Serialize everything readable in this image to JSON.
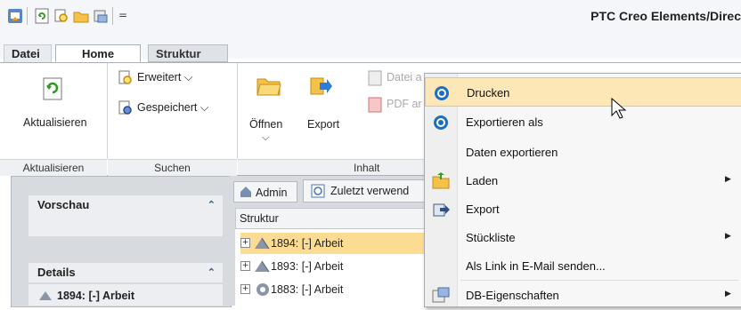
{
  "window": {
    "title": "PTC Creo Elements/Direc"
  },
  "quick_access": {
    "dropdown_glyph": "="
  },
  "tabs": [
    {
      "label": "Datei"
    },
    {
      "label": "Home"
    },
    {
      "label": "Struktur"
    }
  ],
  "ribbon": {
    "aktualisieren": "Aktualisieren",
    "erweitert": "Erweitert",
    "gespeichert": "Gespeichert",
    "oeffnen": "Öffnen",
    "export": "Export",
    "datei_partial": "Datei a",
    "pdf_partial": "PDF ar",
    "groups": {
      "aktualisieren": "Aktualisieren",
      "suchen": "Suchen",
      "inhalt": "Inhalt"
    }
  },
  "left_panel": {
    "vorschau": "Vorschau",
    "details": "Details",
    "details_item": "1894: [-] Arbeit"
  },
  "main": {
    "admin_button": "Admin",
    "zuletzt_tab": "Zuletzt verwend",
    "tree_header": "Struktur",
    "rows": [
      {
        "label": "1894: [-] Arbeit",
        "selected": true
      },
      {
        "label": "1893: [-] Arbeit",
        "selected": false
      },
      {
        "label": "1883: [-] Arbeit",
        "selected": false
      }
    ]
  },
  "context_menu": {
    "items": [
      {
        "label": "Drucken",
        "icon": "print-icon",
        "submenu": false,
        "hover": true
      },
      {
        "label": "Exportieren als",
        "icon": "export-as-icon",
        "submenu": false
      },
      {
        "label": "Daten exportieren",
        "icon": "",
        "submenu": false
      },
      {
        "label": "Laden",
        "icon": "load-icon",
        "submenu": true
      },
      {
        "label": "Export",
        "icon": "export-icon",
        "submenu": false
      },
      {
        "label": "Stückliste",
        "icon": "",
        "submenu": true
      },
      {
        "label": "Als Link in E-Mail senden...",
        "icon": "",
        "submenu": false
      },
      {
        "label": "DB-Eigenschaften",
        "icon": "db-properties-icon",
        "submenu": true
      }
    ]
  },
  "colors": {
    "accent": "#fde7b6",
    "selection": "#fbdc92",
    "panel_bg": "#d7dbe0"
  }
}
